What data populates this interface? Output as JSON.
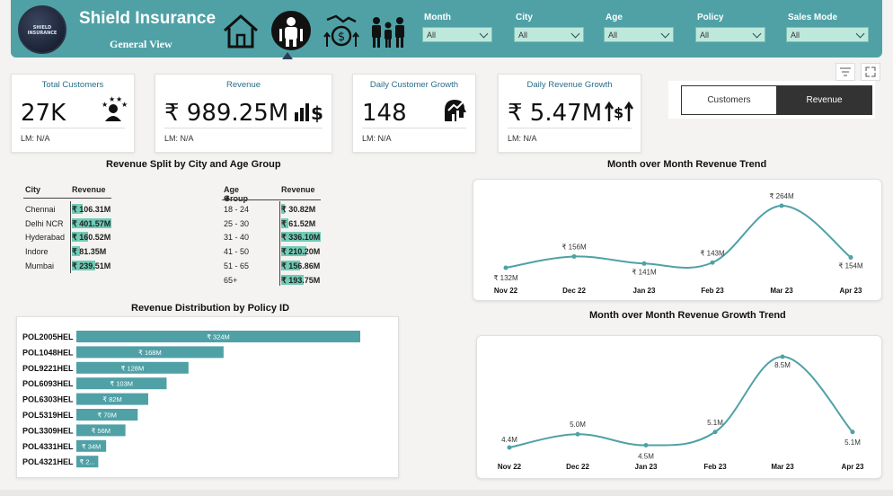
{
  "header": {
    "logo_text": "SHIELD INSURANCE",
    "title": "Shield Insurance",
    "subtitle": "General View",
    "nav_icons": [
      "home-icon",
      "customers-icon",
      "revenue-icon",
      "family-icon"
    ]
  },
  "filters": [
    {
      "label": "Month",
      "value": "All"
    },
    {
      "label": "City",
      "value": "All"
    },
    {
      "label": "Age",
      "value": "All"
    },
    {
      "label": "Policy",
      "value": "All"
    },
    {
      "label": "Sales Mode",
      "value": "All"
    }
  ],
  "kpis": [
    {
      "title": "Total Customers",
      "value": "27K",
      "lm": "LM: N/A",
      "icon": "customers-stars-icon"
    },
    {
      "title": "Revenue",
      "value": "₹ 989.25M",
      "lm": "LM: N/A",
      "icon": "rupee-chart-icon"
    },
    {
      "title": "Daily Customer Growth",
      "value": "148",
      "lm": "LM: N/A",
      "icon": "head-growth-icon"
    },
    {
      "title": "Daily Revenue Growth",
      "value": "₹ 5.47M",
      "lm": "LM: N/A",
      "icon": "revenue-growth-icon"
    }
  ],
  "toggle": {
    "customers": "Customers",
    "revenue": "Revenue",
    "active": "Revenue"
  },
  "city_table": {
    "title": "Revenue Split by City and Age Group",
    "col_city": "City",
    "col_revenue": "Revenue",
    "rows": [
      {
        "city": "Chennai",
        "revenue": "₹ 106.31M",
        "fraction": 0.265
      },
      {
        "city": "Delhi NCR",
        "revenue": "₹ 401.57M",
        "fraction": 1.0
      },
      {
        "city": "Hyderabad",
        "revenue": "₹ 160.52M",
        "fraction": 0.4
      },
      {
        "city": "Indore",
        "revenue": "₹ 81.35M",
        "fraction": 0.203
      },
      {
        "city": "Mumbai",
        "revenue": "₹ 239.51M",
        "fraction": 0.596
      }
    ]
  },
  "age_table": {
    "col_age": "Age Group",
    "col_revenue": "Revenue",
    "rows": [
      {
        "age": "18 - 24",
        "revenue": "₹ 30.82M",
        "fraction": 0.092
      },
      {
        "age": "25 - 30",
        "revenue": "₹ 61.52M",
        "fraction": 0.183
      },
      {
        "age": "31 - 40",
        "revenue": "₹ 336.10M",
        "fraction": 1.0
      },
      {
        "age": "41 - 50",
        "revenue": "₹ 210.20M",
        "fraction": 0.625
      },
      {
        "age": "51 - 65",
        "revenue": "₹ 156.86M",
        "fraction": 0.467
      },
      {
        "age": "65+",
        "revenue": "₹ 193.75M",
        "fraction": 0.576
      }
    ]
  },
  "policy_chart": {
    "title": "Revenue Distribution by Policy ID",
    "bar_color": "#4fa1a6",
    "chart_data": {
      "type": "bar",
      "orientation": "horizontal",
      "categories": [
        "POL2005HEL",
        "POL1048HEL",
        "POL9221HEL",
        "POL6093HEL",
        "POL6303HEL",
        "POL5319HEL",
        "POL3309HEL",
        "POL4331HEL",
        "POL4321HEL"
      ],
      "values": [
        324,
        168,
        128,
        103,
        82,
        70,
        56,
        34,
        25
      ],
      "labels": [
        "₹ 324M",
        "₹ 168M",
        "₹ 128M",
        "₹ 103M",
        "₹ 82M",
        "₹ 70M",
        "₹ 56M",
        "₹ 34M",
        "₹ 2..."
      ]
    }
  },
  "trend_chart": {
    "title": "Month over Month Revenue Trend",
    "line_color": "#4fa1a6",
    "chart_data": {
      "type": "line",
      "x": [
        "Nov 22",
        "Dec 22",
        "Jan 23",
        "Feb 23",
        "Mar 23",
        "Apr 23"
      ],
      "values": [
        132,
        156,
        141,
        143,
        264,
        154
      ],
      "labels": [
        "₹ 132M",
        "₹ 156M",
        "₹ 141M",
        "₹ 143M",
        "₹ 264M",
        "₹ 154M"
      ]
    }
  },
  "growth_chart": {
    "title": "Month over Month Revenue Growth Trend",
    "line_color": "#4fa1a6",
    "chart_data": {
      "type": "line",
      "x": [
        "Nov 22",
        "Dec 22",
        "Jan 23",
        "Feb 23",
        "Mar 23",
        "Apr 23"
      ],
      "values": [
        4.4,
        5.0,
        4.5,
        5.1,
        8.5,
        5.1
      ],
      "labels": [
        "4.4M",
        "5.0M",
        "4.5M",
        "5.1M",
        "8.5M",
        "5.1M"
      ]
    }
  }
}
